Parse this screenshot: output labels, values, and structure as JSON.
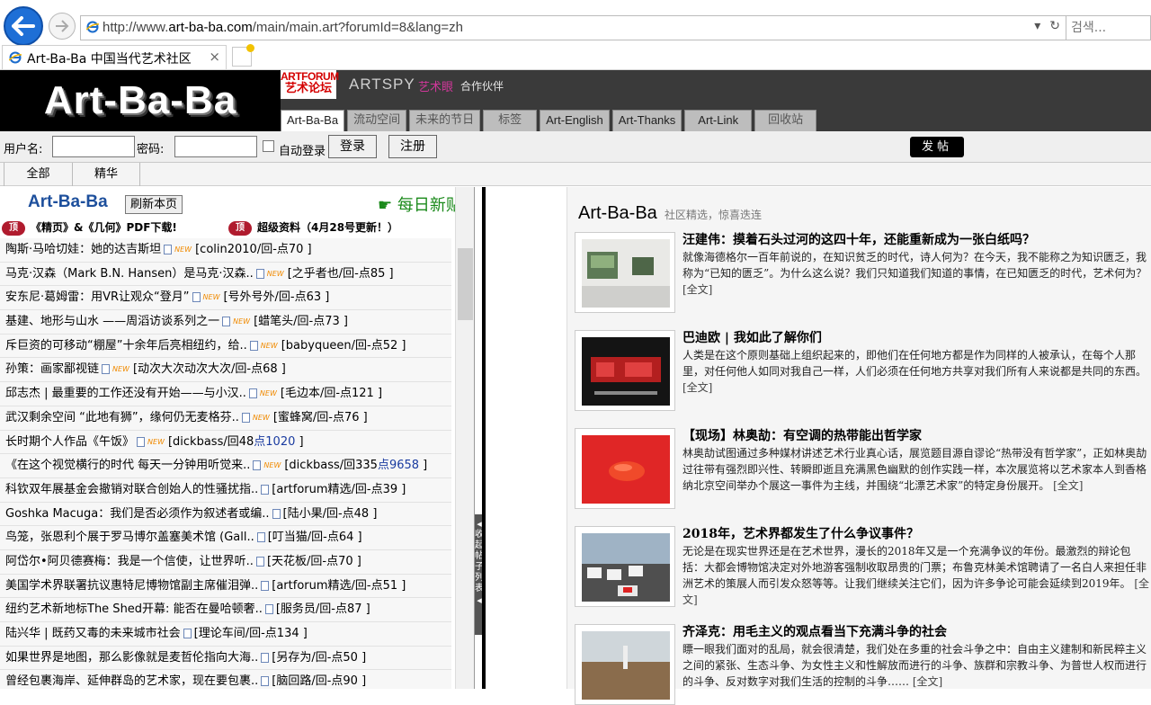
{
  "browser": {
    "url_prefix": "http://www.",
    "url_domain": "art-ba-ba.com",
    "url_path": "/main/main.art?forumId=8&lang=zh",
    "search_placeholder": "검색...",
    "tab_title": "Art-Ba-Ba 中国当代艺术社区",
    "tab_close": "×"
  },
  "header": {
    "logo": "Art-Ba-Ba",
    "artforum_en": "ARTFORUM",
    "artforum_zh": "艺术论坛",
    "artspy": "ARTSPY",
    "artspy_zh": "艺术眼",
    "partner": "合作伙伴",
    "tabs": [
      {
        "label": "Art-Ba-Ba",
        "active": true
      },
      {
        "label": "流动空间"
      },
      {
        "label": "未来的节日"
      },
      {
        "label": "标签"
      },
      {
        "label": "Art-English"
      },
      {
        "label": "Art-Thanks"
      },
      {
        "label": "Art-Link"
      },
      {
        "label": "回收站"
      }
    ]
  },
  "login": {
    "username_label": "用户名:",
    "password_label": "密码:",
    "remember_label": "自动登录",
    "login_button": "登录",
    "register_button": "注册",
    "post_button": "发帖"
  },
  "filters": [
    "全部",
    "精华"
  ],
  "left": {
    "logo": "Art-Ba-Ba",
    "refresh": "刷新本页",
    "daily": "每日新贴",
    "pin_badge": "顶",
    "pinned1": "《精页》&《几何》PDF下载!",
    "pinned2": "超级资料（4月28号更新！）",
    "new_label": "NEW",
    "collapse_label": "收起帖子列表",
    "posts": [
      {
        "title": "陶斯·马哈切娃：她的达吉斯坦",
        "meta": "[colin2010/回-点70 ]"
      },
      {
        "title": "马克·汉森（Mark B.N. Hansen）是马克·汉森..",
        "meta": "[之乎者也/回-点85 ]"
      },
      {
        "title": "安东尼·葛姆雷：用VR让观众“登月”",
        "meta": "[号外号外/回-点63 ]"
      },
      {
        "title": "基建、地形与山水 ——周滔访谈系列之一",
        "meta": "[蜡笔头/回-点73 ]"
      },
      {
        "title": "斥巨资的可移动“棚屋”十余年后亮相纽约，给..",
        "meta": "[babyqueen/回-点52 ]"
      },
      {
        "title": "孙策：画家鄙视链",
        "meta": "[动次大次动次大次/回-点68 ]"
      },
      {
        "title": "邱志杰 | 最重要的工作还没有开始——与小汉..",
        "meta": "[毛边本/回-点121 ]"
      },
      {
        "title": "武汉剩余空间 “此地有狮”，缘何仍无麦格芬..",
        "meta": "[蜜蜂窝/回-点76 ]"
      },
      {
        "title": "长时期个人作品《午饭》",
        "meta": "[dickbass/回48",
        "meta_blue": "点1020",
        "meta_end": " ]"
      },
      {
        "title": "《在这个视觉横行的时代 每天一分钟用听觉来..",
        "meta": "[dickbass/回335",
        "meta_blue": "点9658",
        "meta_end": " ]"
      },
      {
        "title": "科钦双年展基金会撤销对联合创始人的性骚扰指..",
        "meta": "[artforum精选/回-点39 ]"
      },
      {
        "title": "Goshka Macuga：我们是否必须作为叙述者或编..",
        "meta": "[陆小果/回-点48 ]"
      },
      {
        "title": "鸟笼，张恩利个展于罗马博尔盖塞美术馆 (Gall..",
        "meta": "[叮当猫/回-点64 ]"
      },
      {
        "title": "阿岱尔•阿贝德赛梅：我是一个信使，让世界听..",
        "meta": "[天花板/回-点70 ]"
      },
      {
        "title": "美国学术界联署抗议惠特尼博物馆副主席催泪弹..",
        "meta": "[artforum精选/回-点51 ]"
      },
      {
        "title": "纽约艺术新地标The Shed开幕: 能否在曼哈顿奢..",
        "meta": "[服务员/回-点87 ]"
      },
      {
        "title": "陆兴华 | 既药又毒的未来城市社会",
        "meta": "[理论车间/回-点134 ]"
      },
      {
        "title": "如果世界是地图，那么影像就是麦哲伦指向大海..",
        "meta": "[另存为/回-点50 ]"
      },
      {
        "title": "曾经包裹海岸、延伸群岛的艺术家，现在要包裹..",
        "meta": "[脑回路/回-点90 ]"
      }
    ]
  },
  "right": {
    "title": "Art-Ba-Ba",
    "subtitle": "社区精选，惊喜迭连",
    "more": "[全文]",
    "articles": [
      {
        "title": "汪建伟：摸着石头过河的这四十年，还能重新成为一张白纸吗？",
        "body": "就像海德格尔一百年前说的，在知识贫乏的时代，诗人何为？在今天，我不能称之为知识匮乏，我称为“已知的匮乏”。为什么这么说？我们只知道我们知道的事情，在已知匮乏的时代，艺术何为？"
      },
      {
        "title": "巴迪欧 | 我如此了解你们",
        "body": "人类是在这个原则基础上组织起来的，即他们在任何地方都是作为同样的人被承认，在每个人那里，对任何他人如同对我自己一样，人们必须在任何地方共享对我们所有人来说都是共同的东西。"
      },
      {
        "title": "【现场】林奥劼：有空调的热带能出哲学家",
        "body": "林奥劼试图通过多种媒材讲述艺术行业真心话，展览题目源自谬论“热带没有哲学家”，正如林奥劼过往带有强烈即兴性、转瞬即逝且充满黑色幽默的创作实践一样，本次展览将以艺术家本人到香格纳北京空间举办个展这一事件为主线，并围绕“北漂艺术家”的特定身份展开。"
      },
      {
        "title": "2018年，艺术界都发生了什么争议事件？",
        "body": "无论是在现实世界还是在艺术世界，漫长的2018年又是一个充满争议的年份。最激烈的辩论包括：大都会博物馆决定对外地游客强制收取昂贵的门票；布鲁克林美术馆聘请了一名白人来担任非洲艺术的策展人而引发众怒等等。让我们继续关注它们，因为许多争论可能会延续到2019年。"
      },
      {
        "title": "齐泽克：用毛主义的观点看当下充满斗争的社会",
        "body": "瞟一眼我们面对的乱局，就会很清楚，我们处在多重的社会斗争之中：自由主义建制和新民粹主义之间的紧张、生态斗争、为女性主义和性解放而进行的斗争、族群和宗教斗争、为普世人权而进行的斗争、反对数字对我们生活的控制的斗争……"
      }
    ]
  }
}
